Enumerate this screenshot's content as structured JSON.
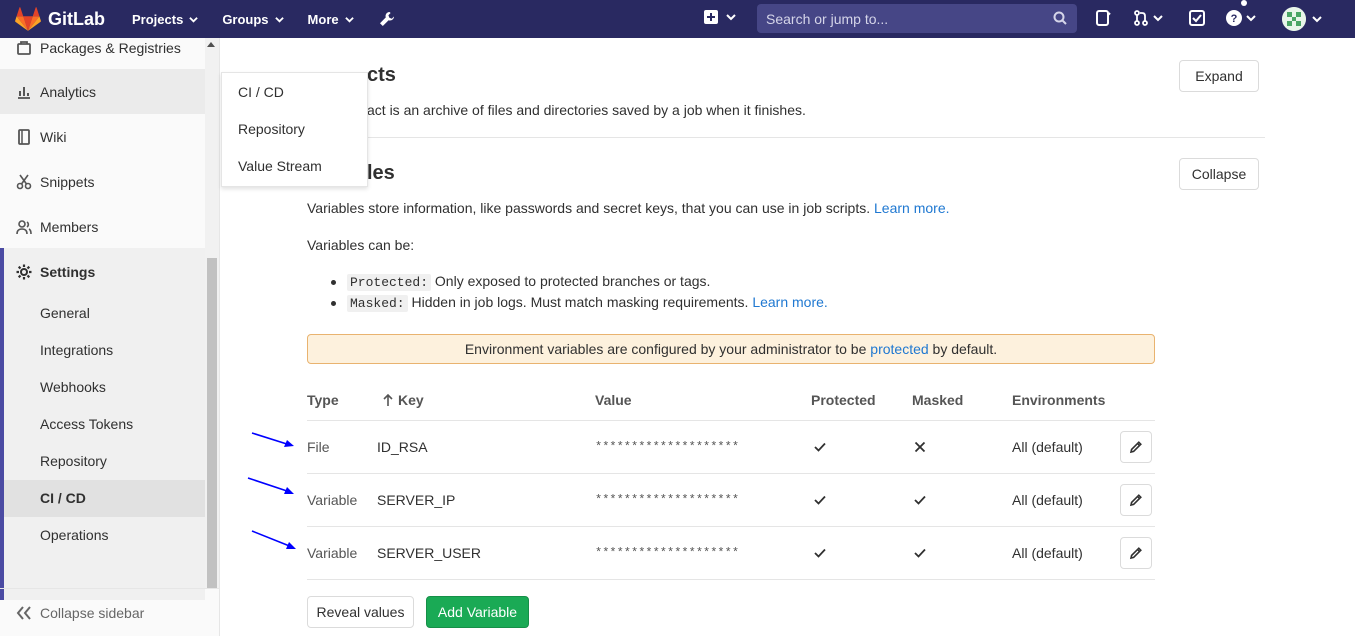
{
  "brand": {
    "name": "GitLab",
    "colors": {
      "navbar": "#292961",
      "accent": "#4b4ba3",
      "link": "#1f78d1",
      "success": "#1aaa55",
      "warning_bg": "#fdf1dd"
    }
  },
  "topnav": {
    "projects": "Projects",
    "groups": "Groups",
    "more": "More",
    "search_placeholder": "Search or jump to..."
  },
  "sidebar": {
    "items": [
      {
        "label": "Packages & Registries",
        "icon": "package-icon"
      },
      {
        "label": "Analytics",
        "icon": "analytics-icon"
      },
      {
        "label": "Wiki",
        "icon": "book-icon"
      },
      {
        "label": "Snippets",
        "icon": "scissors-icon"
      },
      {
        "label": "Members",
        "icon": "users-icon"
      },
      {
        "label": "Settings",
        "icon": "gear-icon"
      }
    ],
    "settings_subitems": [
      "General",
      "Integrations",
      "Webhooks",
      "Access Tokens",
      "Repository",
      "CI / CD",
      "Operations"
    ],
    "collapse_label": "Collapse sidebar"
  },
  "flyout": {
    "items": [
      "CI / CD",
      "Repository",
      "Value Stream"
    ]
  },
  "artifacts": {
    "title_visible": "cts",
    "description_visible": "act is an archive of files and directories saved by a job when it finishes.",
    "button": "Expand"
  },
  "variables": {
    "title_visible": "les",
    "button": "Collapse",
    "intro": "Variables store information, like passwords and secret keys, that you can use in job scripts.",
    "learn_more": "Learn more.",
    "can_be": "Variables can be:",
    "bullets": [
      {
        "code": "Protected:",
        "text": "Only exposed to protected branches or tags.",
        "link": ""
      },
      {
        "code": "Masked:",
        "text": "Hidden in job logs. Must match masking requirements.",
        "link": "Learn more."
      }
    ],
    "alert": {
      "before": "Environment variables are configured by your administrator to be",
      "link": "protected",
      "after": "by default."
    },
    "table": {
      "headers": {
        "type": "Type",
        "key": "Key",
        "value": "Value",
        "protected": "Protected",
        "masked": "Masked",
        "environments": "Environments"
      },
      "rows": [
        {
          "type": "File",
          "key": "ID_RSA",
          "value": "********************",
          "protected": true,
          "masked": false,
          "env": "All (default)"
        },
        {
          "type": "Variable",
          "key": "SERVER_IP",
          "value": "********************",
          "protected": true,
          "masked": true,
          "env": "All (default)"
        },
        {
          "type": "Variable",
          "key": "SERVER_USER",
          "value": "********************",
          "protected": true,
          "masked": true,
          "env": "All (default)"
        }
      ]
    },
    "reveal_button": "Reveal values",
    "add_button": "Add Variable"
  }
}
